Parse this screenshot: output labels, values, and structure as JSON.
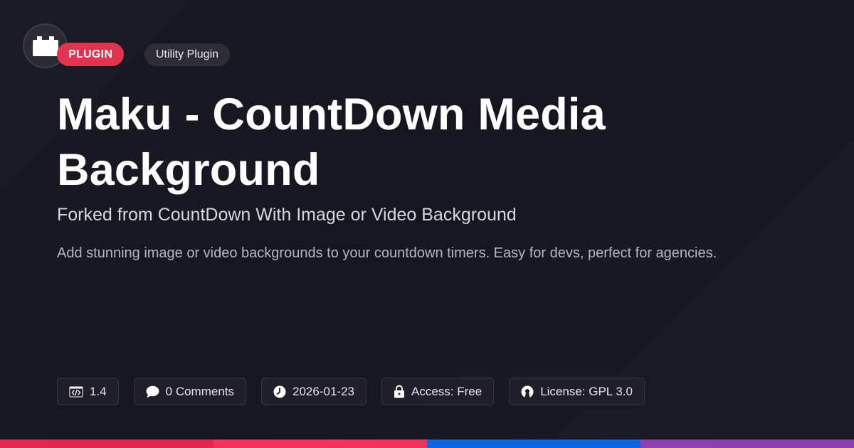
{
  "header": {
    "badge_category": "PLUGIN",
    "badge_type": "Utility Plugin"
  },
  "main": {
    "title": "Maku - CountDown Media Background",
    "subtitle": "Forked from CountDown With Image or Video Background",
    "description": "Add stunning image or video backgrounds to your countdown timers. Easy for devs, perfect for agencies."
  },
  "meta": {
    "version": "1.4",
    "comments": "0 Comments",
    "date": "2026-01-23",
    "access": "Access: Free",
    "license": "License: GPL 3.0"
  },
  "icons": {
    "logo": "plugin-block-icon",
    "version": "code-icon",
    "comments": "comment-bubble-icon",
    "date": "clock-icon",
    "access": "lock-icon",
    "license": "open-source-icon"
  },
  "colors": {
    "badge_category_bg": "#e3334f",
    "bottom_bar": [
      "#e0284f",
      "#f2315c",
      "#0b63e5",
      "#8d3fb0"
    ]
  }
}
